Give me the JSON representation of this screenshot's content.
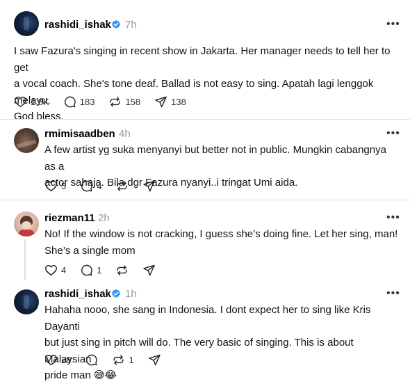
{
  "posts": [
    {
      "username": "rashidi_ishak",
      "verified": true,
      "time": "7h",
      "lines": [
        "I saw Fazura's singing in recent show in Jakarta. Her manager needs to tell her to get",
        "a vocal coach. She's tone deaf. Ballad is not easy to sing. Apatah lagi lenggok melayu.",
        "God bless."
      ],
      "likes": "1.8K",
      "replies": "183",
      "reposts": "158",
      "shares": "138"
    },
    {
      "username": "rmimisaadben",
      "verified": false,
      "time": "4h",
      "lines": [
        "A few artist yg suka menyanyi but better not in public. Mungkin cabangnya as a",
        "actor sahaja. Bila dgr Fazura nyanyi..i tringat Umi aida."
      ],
      "likes": "5",
      "replies": "4"
    },
    {
      "username": "riezman11",
      "verified": false,
      "time": "2h",
      "lines": [
        "No! If the window is not cracking, I guess she’s doing fine. Let her sing, man!",
        "She’s a single mom"
      ],
      "likes": "4",
      "replies": "1"
    },
    {
      "username": "rashidi_ishak",
      "verified": true,
      "time": "1h",
      "lines": [
        "Hahaha nooo, she sang in Indonesia. I dont expect her to sing like Kris Dayanti",
        "but just sing in pitch will do. The very basic of singing. This is about Malaysian",
        "pride man 😅😂"
      ],
      "likes": "28",
      "reposts": "1"
    }
  ],
  "icons": {
    "like": "heart-icon",
    "reply": "comment-icon",
    "repost": "repost-icon",
    "share": "send-icon",
    "more": "more-icon",
    "verified": "verified-badge-icon"
  },
  "colors": {
    "verified": "#3897f0",
    "muted": "#999999",
    "divider": "#e2e2e2"
  }
}
